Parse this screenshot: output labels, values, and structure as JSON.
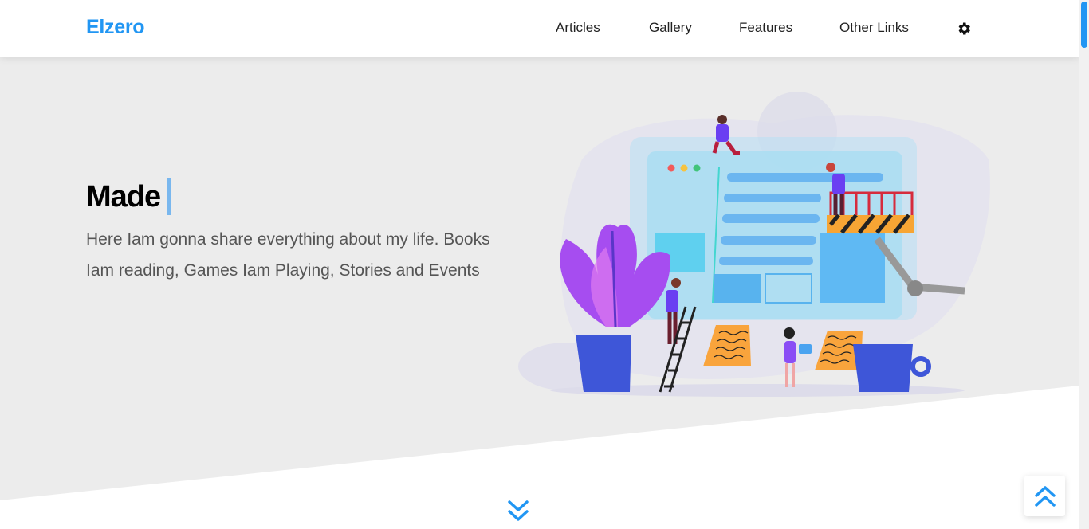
{
  "header": {
    "logo": "Elzero",
    "nav": [
      {
        "label": "Articles"
      },
      {
        "label": "Gallery"
      },
      {
        "label": "Features"
      },
      {
        "label": "Other Links"
      }
    ],
    "settings_icon": "gear-icon"
  },
  "landing": {
    "headline": "Made",
    "description": "Here Iam gonna share everything about my life. Books Iam reading, Games Iam Playing, Stories and Events",
    "illustration_icon": "website-building-illustration"
  },
  "controls": {
    "go_down_icon": "double-chevron-down-icon",
    "go_up_icon": "double-chevron-up-icon"
  },
  "colors": {
    "accent": "#2196f3",
    "landing_bg": "#ececec",
    "text_dark": "#222222",
    "text_muted": "#555555"
  }
}
